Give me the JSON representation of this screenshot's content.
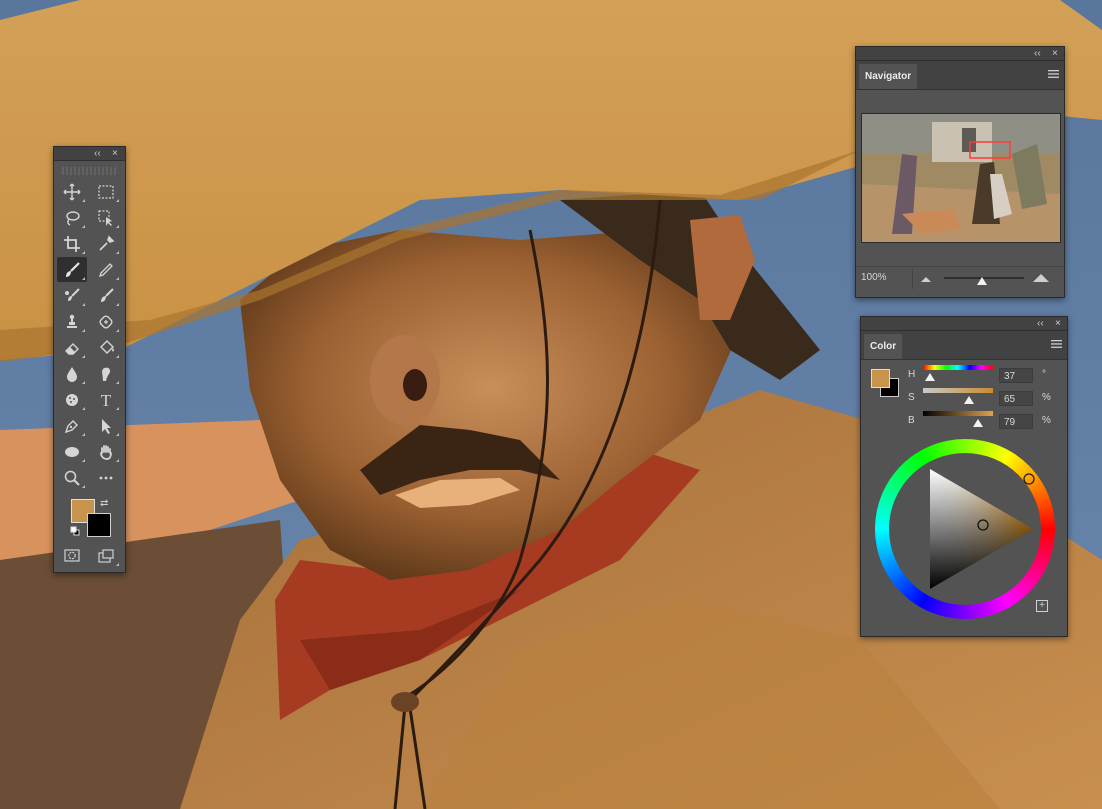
{
  "toolbox": {
    "collapse_label": "‹‹",
    "close_label": "×",
    "tools": [
      {
        "name": "move-tool",
        "icon": "move-icon"
      },
      {
        "name": "rectangular-marquee-tool",
        "icon": "marquee-icon"
      },
      {
        "name": "lasso-tool",
        "icon": "lasso-icon"
      },
      {
        "name": "object-selection-tool",
        "icon": "object-select-icon"
      },
      {
        "name": "crop-tool",
        "icon": "crop-icon"
      },
      {
        "name": "eyedropper-tool",
        "icon": "eyedropper-icon"
      },
      {
        "name": "brush-tool",
        "icon": "brush-icon",
        "active": true
      },
      {
        "name": "pencil-tool",
        "icon": "pencil-icon"
      },
      {
        "name": "mixer-brush-tool",
        "icon": "mixer-brush-icon"
      },
      {
        "name": "history-brush-tool",
        "icon": "history-brush-icon"
      },
      {
        "name": "clone-stamp-tool",
        "icon": "stamp-icon"
      },
      {
        "name": "spot-healing-tool",
        "icon": "healing-icon"
      },
      {
        "name": "eraser-tool",
        "icon": "eraser-icon"
      },
      {
        "name": "paint-bucket-tool",
        "icon": "bucket-icon"
      },
      {
        "name": "blur-tool",
        "icon": "drop-icon"
      },
      {
        "name": "smudge-tool",
        "icon": "smudge-icon"
      },
      {
        "name": "sponge-tool",
        "icon": "sponge-icon"
      },
      {
        "name": "type-tool",
        "icon": "type-icon",
        "glyph": "T"
      },
      {
        "name": "pen-tool",
        "icon": "pen-icon"
      },
      {
        "name": "path-selection-tool",
        "icon": "arrow-icon"
      },
      {
        "name": "ellipse-tool",
        "icon": "ellipse-icon"
      },
      {
        "name": "hand-tool",
        "icon": "hand-icon"
      },
      {
        "name": "zoom-tool",
        "icon": "zoom-icon"
      },
      {
        "name": "more-tools",
        "icon": "more-icon",
        "glyph": "•••"
      },
      {
        "name": "quick-mask-mode",
        "icon": "quick-mask-icon"
      },
      {
        "name": "screen-mode",
        "icon": "screen-mode-icon"
      }
    ],
    "foreground_color": "#c8934b",
    "background_color": "#000000"
  },
  "navigator": {
    "collapse_label": "‹‹",
    "close_label": "×",
    "tab_label": "Navigator",
    "zoom_value": "100%",
    "zoom_slider_fraction": 0.47
  },
  "color": {
    "collapse_label": "‹‹",
    "close_label": "×",
    "tab_label": "Color",
    "h_label": "H",
    "s_label": "S",
    "b_label": "B",
    "h_value": "37",
    "s_value": "65",
    "b_value": "79",
    "h_unit": "°",
    "s_unit": "%",
    "b_unit": "%",
    "add_swatch_label": "+",
    "foreground_color": "#c8934b",
    "background_color": "#000000"
  },
  "colors": {
    "panel": "#535353",
    "panel_header": "#424242",
    "accent_hat": "#cf9a4d",
    "sky": "#5e7ba0",
    "bandana": "#a8361e"
  }
}
